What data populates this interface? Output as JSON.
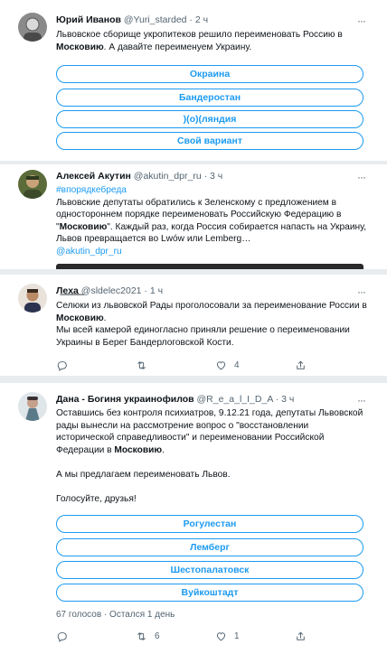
{
  "tweets": [
    {
      "name": "Юрий Иванов",
      "meta": " @Yuri_starded · 2 ч",
      "body_lines": [
        [
          "Львовское сборище укропитеков решило переименовать Россию в"
        ],
        [
          "",
          "Московию",
          ". А давайте переименуем Украину."
        ]
      ],
      "poll": [
        "Окраина",
        "Бандеростан",
        ")(о)(ляндия",
        "Свой вариант"
      ]
    },
    {
      "name": "Алексей Акутин",
      "meta": " @akutin_dpr_ru · 3 ч",
      "hashtag": "#впорядкебреда",
      "body_lines": [
        [
          "Львовские депутаты обратились к Зеленскому с предложением в"
        ],
        [
          "одностороннем порядке переименовать Российскую Федерацию в"
        ],
        [
          "\"",
          "Московию",
          "\". Каждый раз, когда Россия собирается напасть на Украину,"
        ],
        [
          "Львов превращается во Lwów или Lemberg…"
        ]
      ],
      "mention": "@akutin_dpr_ru"
    },
    {
      "name": "Л͟е͟х͟а͟",
      "meta": " @sldelec2021 · 1 ч",
      "body_lines": [
        [
          "Селюки из львовской Рады проголосовали за переименование России в"
        ],
        [
          "",
          "Московию",
          "."
        ],
        [
          "Мы всей камерой единогласно приняли решение о переименовании"
        ],
        [
          "Украины в Берег Бандерлоговской Кости."
        ]
      ],
      "actions": {
        "reply": "",
        "retweet": "",
        "like": "4"
      }
    },
    {
      "name": "Дана - Богиня украинофилов",
      "meta": " @R_e_a_l_I_D_A · 3 ч",
      "body_lines": [
        [
          "Оставшись без контроля психиатров, 9.12.21 года, депутаты Львовской"
        ],
        [
          "рады вынесли на рассмотрение вопрос о \"восстановлении"
        ],
        [
          "исторической справедливости\" и переименовании Российской"
        ],
        [
          "Федерации в ",
          "Московию",
          "."
        ],
        [
          ""
        ],
        [
          "А мы предлагаем переименовать Львов."
        ],
        [
          ""
        ],
        [
          "Голосуйте, друзья!"
        ]
      ],
      "poll": [
        "Рогулестан",
        "Лемберг",
        "Шестопалатовск",
        "Вуйкоштадт"
      ],
      "poll_footer": "67 голосов · Остался 1 день",
      "actions": {
        "reply": "",
        "retweet": "6",
        "like": "1"
      }
    }
  ],
  "colors": {
    "accent": "#1d9bf0",
    "text": "#0f1419",
    "muted": "#536471",
    "divider": "#e9ecef"
  }
}
